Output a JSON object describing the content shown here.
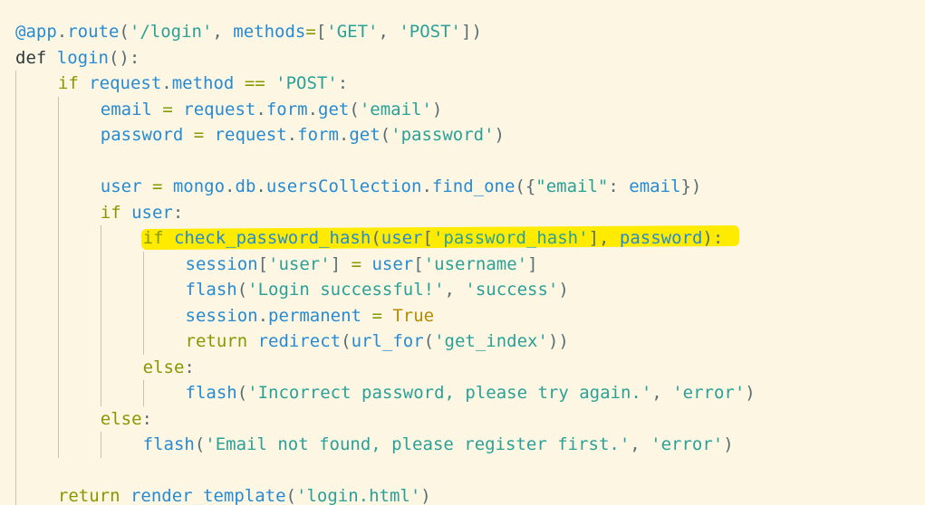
{
  "editor": {
    "highlight_color": "#ffeb00",
    "background_color": "#fdf6e3",
    "lines": [
      {
        "indent": 0,
        "tokens": [
          {
            "t": "dec",
            "s": "@app"
          },
          {
            "t": "pun",
            "s": "."
          },
          {
            "t": "var",
            "s": "route"
          },
          {
            "t": "pun",
            "s": "("
          },
          {
            "t": "str",
            "s": "'/login'"
          },
          {
            "t": "pun",
            "s": ", "
          },
          {
            "t": "var",
            "s": "methods"
          },
          {
            "t": "op",
            "s": "="
          },
          {
            "t": "pun",
            "s": "["
          },
          {
            "t": "str",
            "s": "'GET'"
          },
          {
            "t": "pun",
            "s": ", "
          },
          {
            "t": "str",
            "s": "'POST'"
          },
          {
            "t": "pun",
            "s": "])"
          }
        ]
      },
      {
        "indent": 0,
        "tokens": [
          {
            "t": "def",
            "s": "def "
          },
          {
            "t": "var",
            "s": "login"
          },
          {
            "t": "pun",
            "s": "():"
          }
        ]
      },
      {
        "indent": 4,
        "tokens": [
          {
            "t": "kw",
            "s": "if "
          },
          {
            "t": "var",
            "s": "request"
          },
          {
            "t": "pun",
            "s": "."
          },
          {
            "t": "var",
            "s": "method"
          },
          {
            "t": "op",
            "s": " == "
          },
          {
            "t": "str",
            "s": "'POST'"
          },
          {
            "t": "pun",
            "s": ":"
          }
        ]
      },
      {
        "indent": 8,
        "tokens": [
          {
            "t": "var",
            "s": "email"
          },
          {
            "t": "op",
            "s": " = "
          },
          {
            "t": "var",
            "s": "request"
          },
          {
            "t": "pun",
            "s": "."
          },
          {
            "t": "var",
            "s": "form"
          },
          {
            "t": "pun",
            "s": "."
          },
          {
            "t": "var",
            "s": "get"
          },
          {
            "t": "pun",
            "s": "("
          },
          {
            "t": "str",
            "s": "'email'"
          },
          {
            "t": "pun",
            "s": ")"
          }
        ]
      },
      {
        "indent": 8,
        "tokens": [
          {
            "t": "var",
            "s": "password"
          },
          {
            "t": "op",
            "s": " = "
          },
          {
            "t": "var",
            "s": "request"
          },
          {
            "t": "pun",
            "s": "."
          },
          {
            "t": "var",
            "s": "form"
          },
          {
            "t": "pun",
            "s": "."
          },
          {
            "t": "var",
            "s": "get"
          },
          {
            "t": "pun",
            "s": "("
          },
          {
            "t": "str",
            "s": "'password'"
          },
          {
            "t": "pun",
            "s": ")"
          }
        ]
      },
      {
        "indent": 8,
        "tokens": []
      },
      {
        "indent": 8,
        "tokens": [
          {
            "t": "var",
            "s": "user"
          },
          {
            "t": "op",
            "s": " = "
          },
          {
            "t": "var",
            "s": "mongo"
          },
          {
            "t": "pun",
            "s": "."
          },
          {
            "t": "var",
            "s": "db"
          },
          {
            "t": "pun",
            "s": "."
          },
          {
            "t": "var",
            "s": "usersCollection"
          },
          {
            "t": "pun",
            "s": "."
          },
          {
            "t": "var",
            "s": "find_one"
          },
          {
            "t": "pun",
            "s": "({"
          },
          {
            "t": "str",
            "s": "\"email\""
          },
          {
            "t": "pun",
            "s": ": "
          },
          {
            "t": "var",
            "s": "email"
          },
          {
            "t": "pun",
            "s": "})"
          }
        ]
      },
      {
        "indent": 8,
        "tokens": [
          {
            "t": "kw",
            "s": "if "
          },
          {
            "t": "var",
            "s": "user"
          },
          {
            "t": "pun",
            "s": ":"
          }
        ]
      },
      {
        "indent": 12,
        "highlight": true,
        "tokens": [
          {
            "t": "kw",
            "s": "if "
          },
          {
            "t": "var",
            "s": "check_password_hash"
          },
          {
            "t": "pun",
            "s": "("
          },
          {
            "t": "var",
            "s": "user"
          },
          {
            "t": "pun",
            "s": "["
          },
          {
            "t": "str",
            "s": "'password_hash'"
          },
          {
            "t": "pun",
            "s": "], "
          },
          {
            "t": "var",
            "s": "password"
          },
          {
            "t": "pun",
            "s": "):"
          }
        ]
      },
      {
        "indent": 16,
        "tokens": [
          {
            "t": "var",
            "s": "session"
          },
          {
            "t": "pun",
            "s": "["
          },
          {
            "t": "str",
            "s": "'user'"
          },
          {
            "t": "pun",
            "s": "]"
          },
          {
            "t": "op",
            "s": " = "
          },
          {
            "t": "var",
            "s": "user"
          },
          {
            "t": "pun",
            "s": "["
          },
          {
            "t": "str",
            "s": "'username'"
          },
          {
            "t": "pun",
            "s": "]"
          }
        ]
      },
      {
        "indent": 16,
        "tokens": [
          {
            "t": "var",
            "s": "flash"
          },
          {
            "t": "pun",
            "s": "("
          },
          {
            "t": "str",
            "s": "'Login successful!'"
          },
          {
            "t": "pun",
            "s": ", "
          },
          {
            "t": "str",
            "s": "'success'"
          },
          {
            "t": "pun",
            "s": ")"
          }
        ]
      },
      {
        "indent": 16,
        "tokens": [
          {
            "t": "var",
            "s": "session"
          },
          {
            "t": "pun",
            "s": "."
          },
          {
            "t": "var",
            "s": "permanent"
          },
          {
            "t": "op",
            "s": " = "
          },
          {
            "t": "bool",
            "s": "True"
          }
        ]
      },
      {
        "indent": 16,
        "tokens": [
          {
            "t": "kw",
            "s": "return "
          },
          {
            "t": "var",
            "s": "redirect"
          },
          {
            "t": "pun",
            "s": "("
          },
          {
            "t": "var",
            "s": "url_for"
          },
          {
            "t": "pun",
            "s": "("
          },
          {
            "t": "str",
            "s": "'get_index'"
          },
          {
            "t": "pun",
            "s": "))"
          }
        ]
      },
      {
        "indent": 12,
        "tokens": [
          {
            "t": "kw",
            "s": "else"
          },
          {
            "t": "pun",
            "s": ":"
          }
        ]
      },
      {
        "indent": 16,
        "tokens": [
          {
            "t": "var",
            "s": "flash"
          },
          {
            "t": "pun",
            "s": "("
          },
          {
            "t": "str",
            "s": "'Incorrect password, please try again.'"
          },
          {
            "t": "pun",
            "s": ", "
          },
          {
            "t": "str",
            "s": "'error'"
          },
          {
            "t": "pun",
            "s": ")"
          }
        ]
      },
      {
        "indent": 8,
        "tokens": [
          {
            "t": "kw",
            "s": "else"
          },
          {
            "t": "pun",
            "s": ":"
          }
        ]
      },
      {
        "indent": 12,
        "tokens": [
          {
            "t": "var",
            "s": "flash"
          },
          {
            "t": "pun",
            "s": "("
          },
          {
            "t": "str",
            "s": "'Email not found, please register first.'"
          },
          {
            "t": "pun",
            "s": ", "
          },
          {
            "t": "str",
            "s": "'error'"
          },
          {
            "t": "pun",
            "s": ")"
          }
        ]
      },
      {
        "indent": 4,
        "tokens": []
      },
      {
        "indent": 4,
        "tokens": [
          {
            "t": "kw",
            "s": "return "
          },
          {
            "t": "var",
            "s": "render_template"
          },
          {
            "t": "pun",
            "s": "("
          },
          {
            "t": "str",
            "s": "'login.html'"
          },
          {
            "t": "pun",
            "s": ")"
          }
        ]
      }
    ]
  }
}
